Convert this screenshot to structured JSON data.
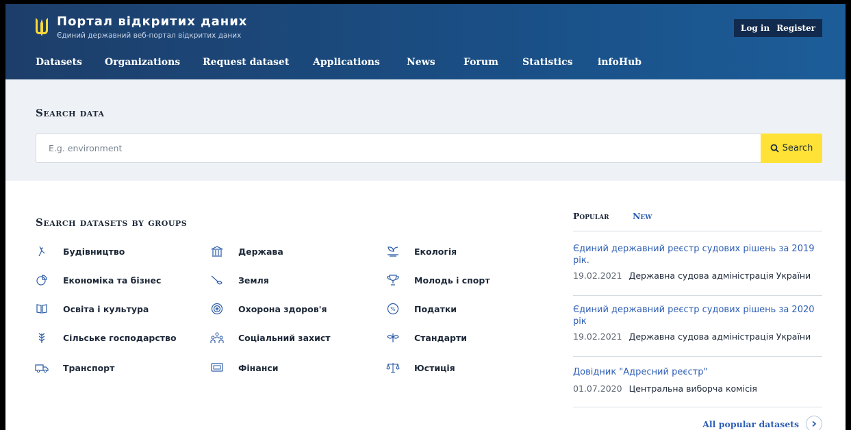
{
  "header": {
    "title": "Портал відкритих даних",
    "subtitle": "Єдиний державний веб-портал відкритих даних",
    "login": "Log in",
    "register": "Register",
    "nav": [
      "Datasets",
      "Organizations",
      "Request dataset",
      "Applications",
      "News",
      "Forum",
      "Statistics",
      "infoHub"
    ]
  },
  "search": {
    "title": "Search data",
    "placeholder": "E.g. environment",
    "button": "Search"
  },
  "groups": {
    "title": "Search datasets by groups",
    "items": [
      {
        "label": "Будівництво",
        "icon": "construction-icon"
      },
      {
        "label": "Держава",
        "icon": "government-building-icon"
      },
      {
        "label": "Екологія",
        "icon": "ecology-icon"
      },
      {
        "label": "Економіка та бізнес",
        "icon": "pie-chart-icon"
      },
      {
        "label": "Земля",
        "icon": "land-icon"
      },
      {
        "label": "Молодь і спорт",
        "icon": "trophy-icon"
      },
      {
        "label": "Освіта і культура",
        "icon": "book-icon"
      },
      {
        "label": "Охорона здоров'я",
        "icon": "health-icon"
      },
      {
        "label": "Податки",
        "icon": "percent-icon"
      },
      {
        "label": "Сільське господарство",
        "icon": "wheat-icon"
      },
      {
        "label": "Соціальний захист",
        "icon": "people-icon"
      },
      {
        "label": "Стандарти",
        "icon": "standards-icon"
      },
      {
        "label": "Транспорт",
        "icon": "truck-icon"
      },
      {
        "label": "Фінанси",
        "icon": "cash-icon"
      },
      {
        "label": "Юстиція",
        "icon": "scales-icon"
      }
    ]
  },
  "datasets": {
    "tab_popular": "Popular",
    "tab_new": "New",
    "items": [
      {
        "title": "Єдиний державний реєстр судових рішень за 2019 рік.",
        "date": "19.02.2021",
        "org": "Державна судова адміністрація України"
      },
      {
        "title": "Єдиний державний реєстр судових рішень за 2020 рік",
        "date": "19.02.2021",
        "org": "Державна судова адміністрація України"
      },
      {
        "title": "Довідник \"Адресний реєстр\"",
        "date": "01.07.2020",
        "org": "Центральна виборча комісія"
      }
    ],
    "all_link": "All popular datasets"
  },
  "colors": {
    "header_bg": "#1a4f86",
    "accent_yellow": "#ffe235",
    "link_blue": "#2e5fb5"
  }
}
